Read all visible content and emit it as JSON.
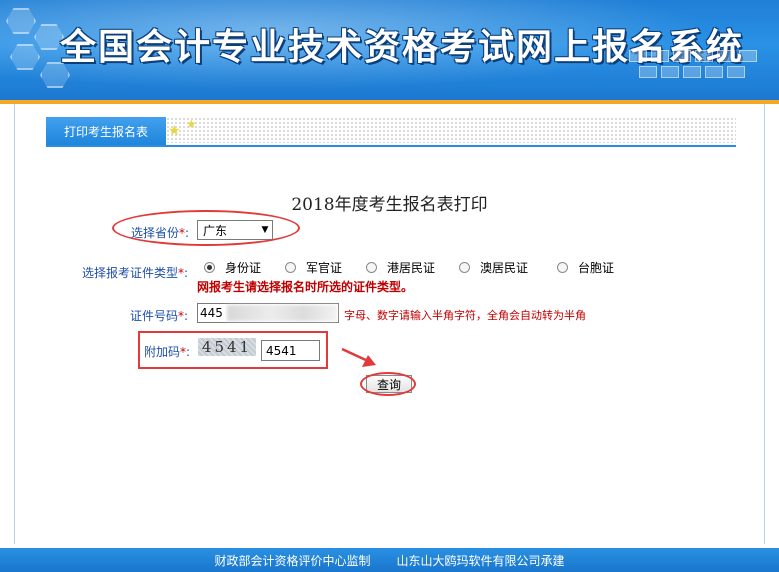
{
  "header": {
    "title": "全国会计专业技术资格考试网上报名系统"
  },
  "tab": {
    "label": "打印考生报名表"
  },
  "page": {
    "heading": "2018年度考生报名表打印"
  },
  "form": {
    "province_label": "选择省份",
    "province_value": "广东",
    "idtype_label": "选择报考证件类型",
    "id_types": [
      "身份证",
      "军官证",
      "港居民证",
      "澳居民证",
      "台胞证"
    ],
    "selected_id_type": "身份证",
    "idtype_warning": "网报考生请选择报名时所选的证件类型。",
    "idnum_label": "证件号码",
    "idnum_value": "445",
    "idnum_hint": "字母、数字请输入半角字符，全角会自动转为半角",
    "captcha_label": "附加码",
    "captcha_image_text": "4541",
    "captcha_value": "4541",
    "required_mark": "*",
    "submit_label": "查询"
  },
  "footer": {
    "supervisor": "财政部会计资格评价中心监制",
    "builder": "山东山大鸥玛软件有限公司承建"
  },
  "colors": {
    "accent": "#1e86dc",
    "label": "#1f4fa8",
    "warning": "#c00000",
    "annotation": "#e23a3a"
  }
}
